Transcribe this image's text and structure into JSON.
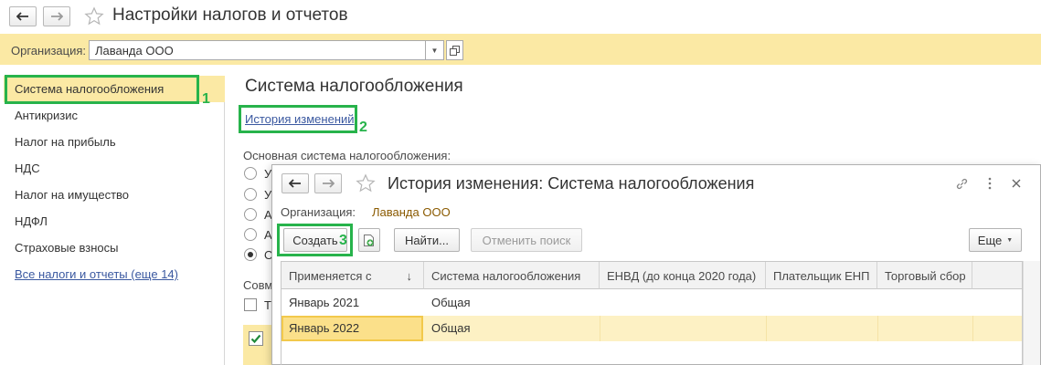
{
  "main_window": {
    "title": "Настройки налогов и отчетов",
    "back_icon": "arrow-left-icon",
    "forward_icon": "arrow-right-icon",
    "favorite_icon": "star-icon"
  },
  "org_bar": {
    "label": "Организация:",
    "value": "Лаванда ООО"
  },
  "sidebar": {
    "items": [
      {
        "label": "Система налогообложения"
      },
      {
        "label": "Антикризис"
      },
      {
        "label": "Налог на прибыль"
      },
      {
        "label": "НДС"
      },
      {
        "label": "Налог на имущество"
      },
      {
        "label": "НДФЛ"
      },
      {
        "label": "Страховые взносы"
      }
    ],
    "all_taxes_link": "Все налоги и отчеты (еще 14)"
  },
  "content": {
    "section_title": "Система налогообложения",
    "history_link": "История изменений",
    "main_tax_label": "Основная система налогообложения:",
    "radio_options": [
      "У",
      "У",
      "А",
      "А",
      "О"
    ],
    "combined_label": "Совм",
    "combined_option": "Т"
  },
  "steps": [
    "1",
    "2",
    "3"
  ],
  "dialog": {
    "title": "История изменения: Система налогообложения",
    "org_label": "Организация:",
    "org_value": "Лаванда ООО",
    "toolbar": {
      "create": "Создать",
      "find": "Найти...",
      "cancel_search": "Отменить поиск",
      "more": "Еще"
    },
    "columns": [
      "Применяется с",
      "Система налогообложения",
      "ЕНВД (до конца 2020 года)",
      "Плательщик ЕНП",
      "Торговый сбор"
    ],
    "sort_indicator": "↓",
    "rows": [
      {
        "date": "Январь 2021",
        "system": "Общая"
      },
      {
        "date": "Январь 2022",
        "system": "Общая"
      }
    ]
  },
  "colors": {
    "accent_yellow": "#fbe9a4",
    "highlight_green": "#27b34b",
    "link_blue": "#3a58a0"
  }
}
